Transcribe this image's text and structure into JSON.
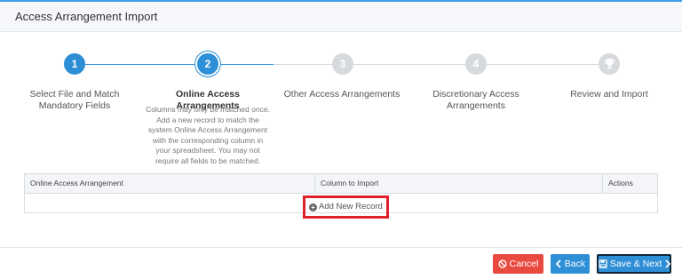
{
  "header": {
    "title": "Access Arrangement Import"
  },
  "wizard": {
    "steps": [
      {
        "number": "1",
        "label": "Select File and Match Mandatory Fields",
        "state": "done"
      },
      {
        "number": "2",
        "label": "Online Access Arrangements",
        "state": "active",
        "description": "Columns may only be matched once. Add a new record to match the system Online Access Arrangement with the corresponding column in your spreadsheet. You may not require all fields to be matched."
      },
      {
        "number": "3",
        "label": "Other Access Arrangements",
        "state": "todo"
      },
      {
        "number": "4",
        "label": "Discretionary Access Arrangements",
        "state": "todo"
      },
      {
        "icon": "trophy-icon",
        "label": "Review and Import",
        "state": "todo"
      }
    ]
  },
  "table": {
    "columns": [
      "Online Access Arrangement",
      "Column to Import",
      "Actions"
    ],
    "add_record_label": "Add New Record"
  },
  "footer": {
    "cancel_label": "Cancel",
    "back_label": "Back",
    "save_next_label": "Save & Next"
  },
  "colors": {
    "accent": "#2e8fd6",
    "danger": "#e94a3f",
    "inactive": "#d6d9dd",
    "highlight": "#e0212b"
  }
}
